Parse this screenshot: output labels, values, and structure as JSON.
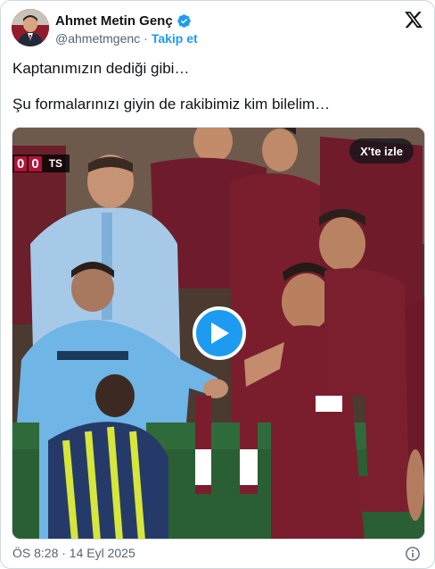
{
  "author": {
    "name": "Ahmet Metin Genç",
    "handle": "@ahmetmgenc",
    "separator": "·",
    "follow_label": "Takip et",
    "avatar_icon": "profile-photo",
    "verified_icon": "verified-badge-icon"
  },
  "tweet": {
    "lines": [
      "Kaptanımızın dediği gibi…",
      "Şu formalarınızı giyin de rakibimiz kim bilelim…"
    ]
  },
  "media": {
    "watch_label": "X'te izle",
    "scoreboard": {
      "home_score": "0",
      "away_score": "0",
      "team": "TS"
    },
    "play_icon": "play-icon"
  },
  "footer": {
    "timestamp": "ÖS 8:28 · 14 Eyl 2025",
    "info_icon": "info-icon"
  },
  "colors": {
    "accent": "#1d9bf0",
    "text": "#0f1419",
    "muted": "#536471",
    "border": "#cfd9de"
  }
}
